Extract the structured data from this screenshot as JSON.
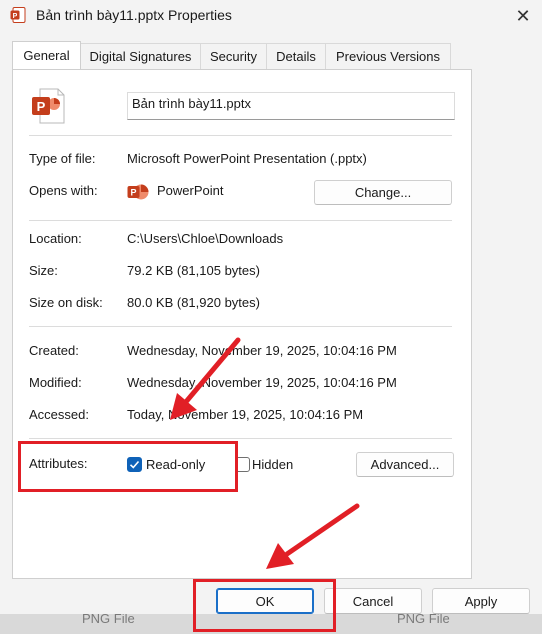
{
  "window": {
    "title": "Bản trình bày11.pptx Properties",
    "close_symbol": "✕"
  },
  "tabs": [
    "General",
    "Digital Signatures",
    "Security",
    "Details",
    "Previous Versions"
  ],
  "file": {
    "name": "Bản trình bày11.pptx"
  },
  "type_of_file": {
    "label": "Type of file:",
    "value": "Microsoft PowerPoint Presentation (.pptx)"
  },
  "opens_with": {
    "label": "Opens with:",
    "app": "PowerPoint",
    "button": "Change..."
  },
  "location": {
    "label": "Location:",
    "value": "C:\\Users\\Chloe\\Downloads"
  },
  "size": {
    "label": "Size:",
    "value": "79.2 KB (81,105 bytes)"
  },
  "size_on_disk": {
    "label": "Size on disk:",
    "value": "80.0 KB (81,920 bytes)"
  },
  "created": {
    "label": "Created:",
    "value": "Wednesday, November 19, 2025, 10:04:16 PM"
  },
  "modified": {
    "label": "Modified:",
    "value": "Wednesday, November 19, 2025, 10:04:16 PM"
  },
  "accessed": {
    "label": "Accessed:",
    "value": "Today, November 19, 2025, 10:04:16 PM"
  },
  "attributes": {
    "label": "Attributes:",
    "read_only": {
      "label": "Read-only",
      "checked": true
    },
    "hidden": {
      "label": "Hidden",
      "checked": false
    },
    "advanced_button": "Advanced..."
  },
  "footer": {
    "ok": "OK",
    "cancel": "Cancel",
    "apply": "Apply"
  },
  "background_strip": {
    "left_text": "PNG File",
    "right_text": "PNG File"
  },
  "colors": {
    "accent": "#0f62b8",
    "annotation_red": "#e11f26",
    "powerpoint": "#c43e1c"
  }
}
